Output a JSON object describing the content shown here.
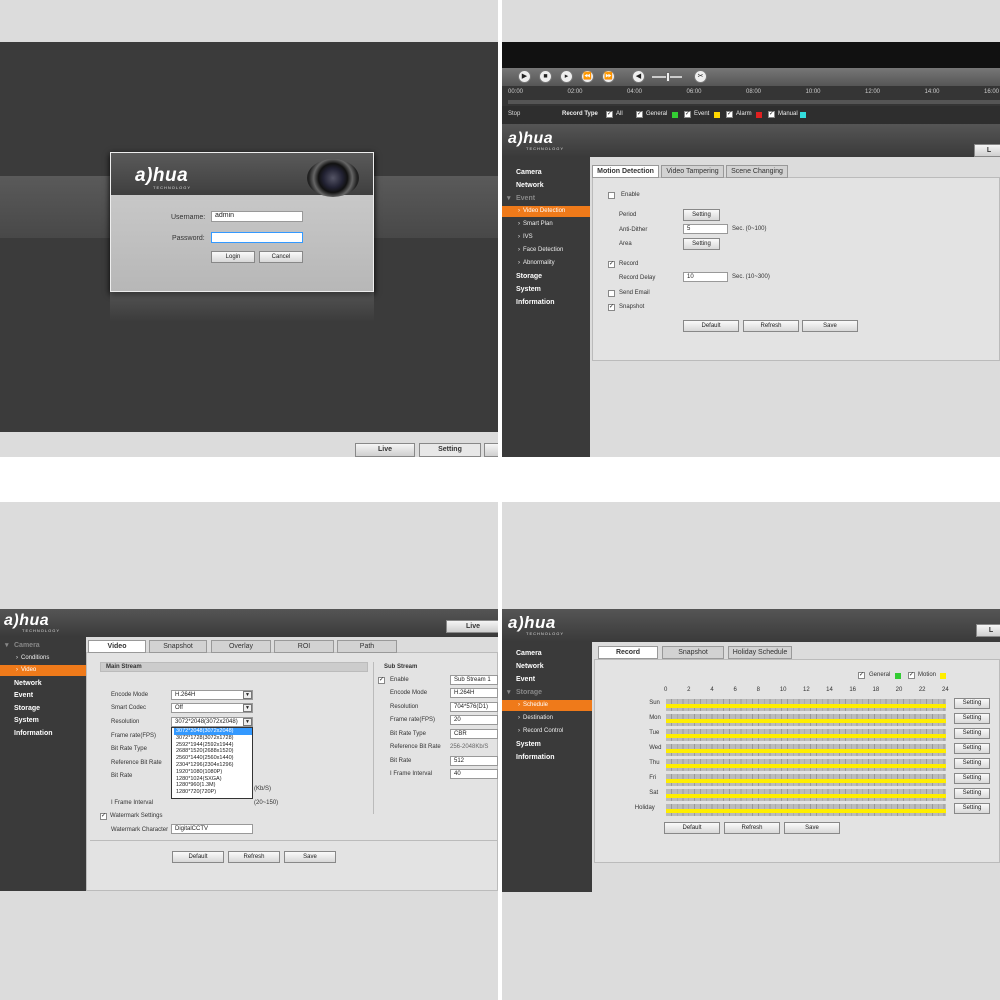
{
  "login": {
    "username_label": "Username:",
    "username_value": "admin",
    "password_label": "Password:",
    "password_value": "",
    "login_button": "Login",
    "cancel_button": "Cancel",
    "logo": "a)hua",
    "logo_tech": "TECHNOLOGY",
    "tab_live": "Live",
    "tab_setting": "Setting"
  },
  "motion": {
    "timeline": [
      "00:00",
      "02:00",
      "04:00",
      "06:00",
      "08:00",
      "10:00",
      "12:00",
      "14:00",
      "16:00"
    ],
    "stop_label": "Stop",
    "record_type_label": "Record Type",
    "legend": [
      {
        "label": "All",
        "color": ""
      },
      {
        "label": "General",
        "color": "#33cc33"
      },
      {
        "label": "Event",
        "color": "#ffd700"
      },
      {
        "label": "Alarm",
        "color": "#e02020"
      },
      {
        "label": "Manual",
        "color": "#33dddd"
      }
    ],
    "logo": "a)hua",
    "logo_tech": "TECHNOLOGY",
    "top_tab": "L",
    "menu": [
      {
        "label": "Camera",
        "type": "item"
      },
      {
        "label": "Network",
        "type": "item"
      },
      {
        "label": "Event",
        "type": "dim"
      },
      {
        "label": "Video Detection",
        "type": "sel"
      },
      {
        "label": "Smart Plan",
        "type": "sub"
      },
      {
        "label": "IVS",
        "type": "sub"
      },
      {
        "label": "Face Detection",
        "type": "sub"
      },
      {
        "label": "Abnormality",
        "type": "sub"
      },
      {
        "label": "Storage",
        "type": "item"
      },
      {
        "label": "System",
        "type": "item"
      },
      {
        "label": "Information",
        "type": "item"
      }
    ],
    "tabs": [
      "Motion Detection",
      "Video Tampering",
      "Scene Changing"
    ],
    "enable_label": "Enable",
    "period_label": "Period",
    "setting_btn": "Setting",
    "antidither_label": "Anti-Dither",
    "antidither_value": "5",
    "antidither_hint": "Sec. (0~100)",
    "area_label": "Area",
    "record_label": "Record",
    "record_delay_label": "Record Delay",
    "record_delay_value": "10",
    "record_delay_hint": "Sec. (10~300)",
    "send_email_label": "Send Email",
    "snapshot_label": "Snapshot",
    "default_btn": "Default",
    "refresh_btn": "Refresh",
    "save_btn": "Save"
  },
  "video": {
    "logo": "a)hua",
    "logo_tech": "TECHNOLOGY",
    "top_tab": "Live",
    "menu": [
      {
        "label": "Camera",
        "type": "dim"
      },
      {
        "label": "Conditions",
        "type": "sub"
      },
      {
        "label": "Video",
        "type": "sel"
      },
      {
        "label": "Network",
        "type": "item"
      },
      {
        "label": "Event",
        "type": "item"
      },
      {
        "label": "Storage",
        "type": "item"
      },
      {
        "label": "System",
        "type": "item"
      },
      {
        "label": "Information",
        "type": "item"
      }
    ],
    "tabs": [
      "Video",
      "Snapshot",
      "Overlay",
      "ROI",
      "Path"
    ],
    "main_stream": "Main Stream",
    "sub_stream": "Sub Stream",
    "encode_mode_label": "Encode Mode",
    "encode_mode_value": "H.264H",
    "smart_codec_label": "Smart Codec",
    "smart_codec_value": "Off",
    "resolution_label": "Resolution",
    "resolution_value": "3072*2048(3072x2048)",
    "frame_rate_label": "Frame rate(FPS)",
    "bit_rate_type_label": "Bit Rate Type",
    "ref_bit_rate_label": "Reference Bit Rate",
    "bit_rate_label": "Bit Rate",
    "kbs_hint": "(Kb/S)",
    "iframe_label": "I Frame Interval",
    "iframe_hint": "(20~150)",
    "watermark_settings_label": "Watermark Settings",
    "watermark_char_label": "Watermark Character",
    "watermark_char_value": "DigitalCCTV",
    "resolution_options": [
      "3072*2048(3072x2048)",
      "3072*1728(3072x1728)",
      "2592*1944(2592x1944)",
      "2688*1520(2688x1520)",
      "2560*1440(2560x1440)",
      "2304*1296(2304x1296)",
      "1920*1080(1080P)",
      "1280*1024(SXGA)",
      "1280*960(1.3M)",
      "1280*720(720P)"
    ],
    "sub_enable_label": "Enable",
    "sub_stream_value": "Sub Stream 1",
    "sub_encode_value": "H.264H",
    "sub_resolution_value": "704*576(D1)",
    "sub_frame_rate_label": "Frame rate(FPS)",
    "sub_frame_rate_value": "20",
    "sub_bit_rate_type_value": "CBR",
    "sub_ref_bit_rate_value": "256-2048Kb/S",
    "sub_bit_rate_value": "512",
    "sub_iframe_value": "40",
    "default_btn": "Default",
    "refresh_btn": "Refresh",
    "save_btn": "Save"
  },
  "schedule": {
    "logo": "a)hua",
    "logo_tech": "TECHNOLOGY",
    "top_tab": "L",
    "menu": [
      {
        "label": "Camera",
        "type": "item"
      },
      {
        "label": "Network",
        "type": "item"
      },
      {
        "label": "Event",
        "type": "item"
      },
      {
        "label": "Storage",
        "type": "dim"
      },
      {
        "label": "Schedule",
        "type": "sel"
      },
      {
        "label": "Destination",
        "type": "sub"
      },
      {
        "label": "Record Control",
        "type": "sub"
      },
      {
        "label": "System",
        "type": "item"
      },
      {
        "label": "Information",
        "type": "item"
      }
    ],
    "tabs": [
      "Record",
      "Snapshot",
      "Holiday Schedule"
    ],
    "legend_general": "General",
    "legend_motion": "Motion",
    "general_color": "#33cc33",
    "motion_color": "#ffee00",
    "hours": [
      "0",
      "2",
      "4",
      "6",
      "8",
      "10",
      "12",
      "14",
      "16",
      "18",
      "20",
      "22",
      "24"
    ],
    "days": [
      "Sun",
      "Mon",
      "Tue",
      "Wed",
      "Thu",
      "Fri",
      "Sat",
      "Holiday"
    ],
    "setting_btn": "Setting",
    "default_btn": "Default",
    "refresh_btn": "Refresh",
    "save_btn": "Save"
  }
}
